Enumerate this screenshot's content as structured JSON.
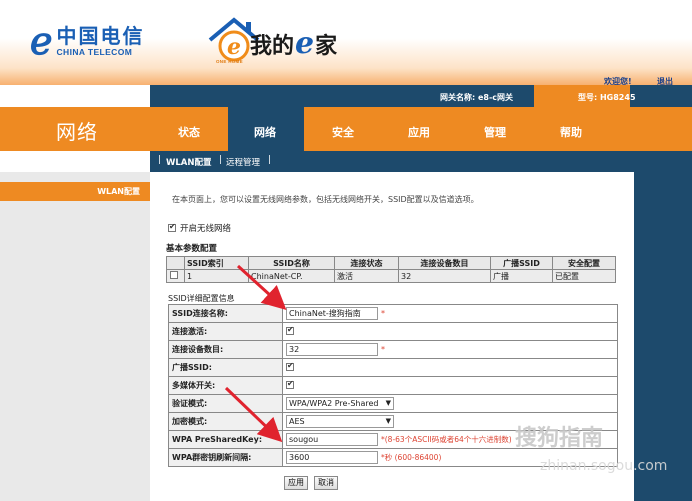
{
  "header": {
    "brand_mark": "ℯ",
    "brand_cn": "中国电信",
    "brand_en": "CHINA TELECOM",
    "home_prefix": "我的",
    "home_e": "e",
    "home_suffix": "家",
    "home_caption": "ONE HOME"
  },
  "topbar": {
    "welcome": "欢迎您!",
    "logout": "退出",
    "gateway_name": "网关名称: e8-c网关",
    "model": "型号: HG8245"
  },
  "section_title": "网络",
  "nav": {
    "tabs": [
      "状态",
      "网络",
      "安全",
      "应用",
      "管理",
      "帮助"
    ],
    "active": "网络"
  },
  "subnav": {
    "items": [
      "WLAN配置",
      "远程管理"
    ]
  },
  "left_menu": {
    "items": [
      "WLAN配置"
    ]
  },
  "content": {
    "description": "在本页面上，您可以设置无线网络参数，包括无线网络开关，SSID配置以及信道选项。",
    "enable_wifi_label": "开启无线网络",
    "enable_wifi_checked": true,
    "basic_title": "基本参数配置",
    "ssid_table": {
      "headers": [
        "",
        "SSID索引",
        "SSID名称",
        "连接状态",
        "连接设备数目",
        "广播SSID",
        "安全配置"
      ],
      "rows": [
        [
          "",
          "1",
          "ChinaNet-CP.",
          "激活",
          "32",
          "广播",
          "已配置"
        ]
      ]
    },
    "detail_title": "SSID详细配置信息",
    "detail": {
      "ssid_name_label": "SSID连接名称:",
      "ssid_name_value": "ChinaNet-搜狗指南",
      "active_label": "连接激活:",
      "devices_label": "连接设备数目:",
      "devices_value": "32",
      "broadcast_label": "广播SSID:",
      "multimedia_label": "多媒体开关:",
      "auth_label": "验证模式:",
      "auth_value": "WPA/WPA2 Pre-Shared",
      "encrypt_label": "加密模式:",
      "encrypt_value": "AES",
      "psk_label": "WPA PreSharedKey:",
      "psk_value": "sougou",
      "psk_hint": "*(8-63个ASCII码或者64个十六进制数)",
      "rekey_label": "WPA群密钥刷新间隔:",
      "rekey_value": "3600",
      "rekey_hint": "*秒 (600-86400)",
      "required_mark": "*"
    },
    "apply_label": "应用",
    "cancel_label": "取消"
  },
  "watermark": {
    "text": "搜狗指南",
    "url": "zhinan.sogou.com"
  },
  "colors": {
    "orange": "#ee8a22",
    "navy": "#1d4a6c",
    "brand_blue": "#1a5fb4",
    "annotation_red": "#e0232e"
  }
}
